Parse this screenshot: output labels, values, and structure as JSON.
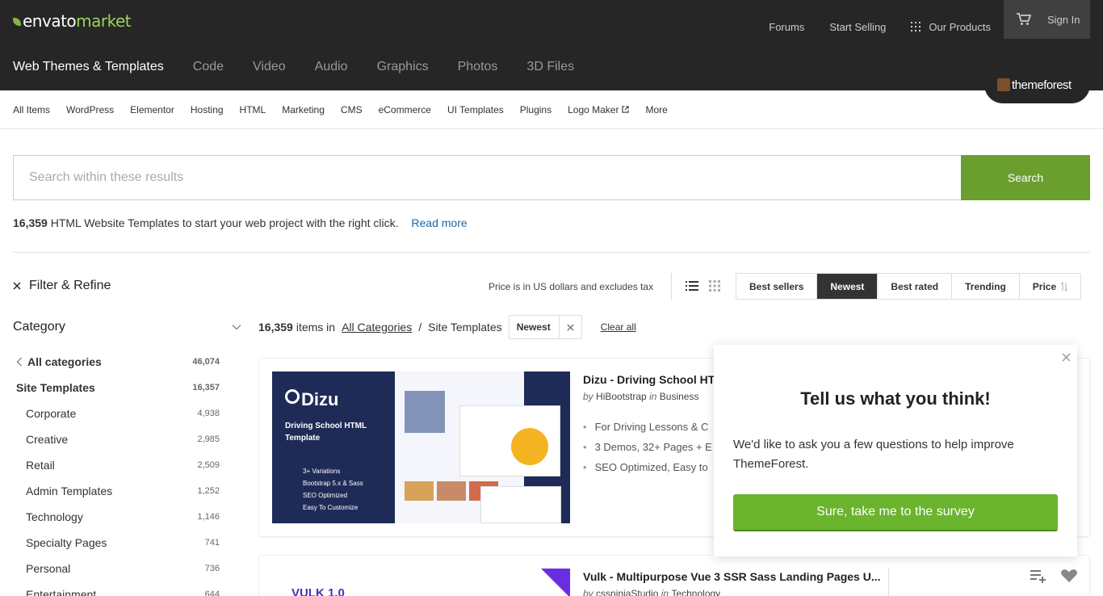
{
  "header": {
    "logo_part1": "envato",
    "logo_part2": "market",
    "links": [
      "Forums",
      "Start Selling"
    ],
    "products_label": "Our Products",
    "signin_label": "Sign In",
    "categories": [
      "Web Themes & Templates",
      "Code",
      "Video",
      "Audio",
      "Graphics",
      "Photos",
      "3D Files"
    ],
    "badge_label": "themeforest"
  },
  "subnav": {
    "items": [
      "All Items",
      "WordPress",
      "Elementor",
      "Hosting",
      "HTML",
      "Marketing",
      "CMS",
      "eCommerce",
      "UI Templates",
      "Plugins",
      "Logo Maker",
      "More"
    ]
  },
  "search": {
    "placeholder": "Search within these results",
    "button_label": "Search"
  },
  "description": {
    "count": "16,359",
    "text": " HTML Website Templates to start your web project with the right click.",
    "read_more": "Read more"
  },
  "filter": {
    "title": "Filter & Refine",
    "price_note": "Price is in US dollars and excludes tax",
    "sort_options": [
      "Best sellers",
      "Newest",
      "Best rated",
      "Trending",
      "Price"
    ],
    "active_sort": "Newest"
  },
  "sidebar": {
    "title": "Category",
    "items": [
      {
        "label": "All categories",
        "count": "46,074"
      },
      {
        "label": "Site Templates",
        "count": "16,357"
      },
      {
        "label": "Corporate",
        "count": "4,938"
      },
      {
        "label": "Creative",
        "count": "2,985"
      },
      {
        "label": "Retail",
        "count": "2,509"
      },
      {
        "label": "Admin Templates",
        "count": "1,252"
      },
      {
        "label": "Technology",
        "count": "1,146"
      },
      {
        "label": "Specialty Pages",
        "count": "741"
      },
      {
        "label": "Personal",
        "count": "736"
      },
      {
        "label": "Entertainment",
        "count": "644"
      }
    ]
  },
  "results": {
    "count": "16,359",
    "items_in": "items in",
    "all_categories": "All Categories",
    "separator": "/",
    "current": "Site Templates",
    "tag": "Newest",
    "clear_all": "Clear all"
  },
  "items": [
    {
      "title": "Dizu - Driving School HTML",
      "by": "by",
      "author": "HiBootstrap",
      "in": "in",
      "category": "Business",
      "bullets": [
        "For Driving Lessons & C",
        "3 Demos, 32+ Pages + E",
        "SEO Optimized, Easy to"
      ],
      "thumb_title": "Dizu",
      "thumb_sub": "Driving School HTML Template",
      "thumb_list": [
        "3+ Variations",
        "Bootstrap 5.x & Sass",
        "SEO Optimized",
        "Easy To Customize"
      ]
    },
    {
      "title": "Vulk - Multipurpose Vue 3 SSR Sass Landing Pages U...",
      "by": "by",
      "author": "cssninjaStudio",
      "in": "in",
      "category": "Technology",
      "thumb_logo": "VULK 1.0"
    }
  ],
  "survey": {
    "title": "Tell us what you think!",
    "body": "We'd like to ask you a few questions to help improve ThemeForest.",
    "button": "Sure, take me to the survey"
  },
  "colors": {
    "topbar": "#262626",
    "accent_green": "#82b541",
    "search_button": "#6a9f2e",
    "survey_button": "#6ab42e",
    "link_blue": "#1a6aa8"
  }
}
